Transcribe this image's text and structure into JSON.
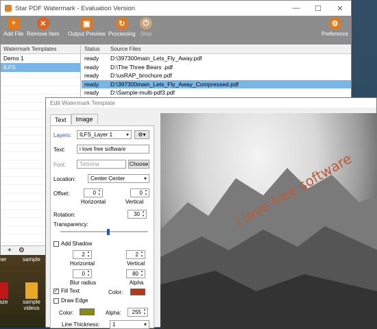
{
  "window": {
    "title": "Star PDF Watermark - Evaluation Version"
  },
  "toolbar": {
    "add_file": "Add File",
    "remove_item": "Remove Item",
    "output_preview": "Output Preview",
    "processing": "Processing",
    "stop": "Stop",
    "preference": "Preference"
  },
  "templates": {
    "header": "Watermark Templates",
    "items": [
      "Demo 1",
      "ILFS"
    ],
    "selected": "ILFS",
    "footer": [
      "+",
      "⚙"
    ]
  },
  "files": {
    "headers": [
      "Status",
      "Source Files"
    ],
    "rows": [
      {
        "status": "ready",
        "path": "D:\\397300main_Lets_Fly_Away.pdf"
      },
      {
        "status": "ready",
        "path": "D:\\The Three Bears .pdf"
      },
      {
        "status": "ready",
        "path": "D:\\usRAP_brochure.pdf"
      },
      {
        "status": "ready",
        "path": "D:\\397300main_Lets_Fly_Away_Compressed.pdf"
      },
      {
        "status": "ready",
        "path": "D:\\Sample-multi-pdf3.pdf"
      }
    ]
  },
  "desktop": {
    "icons": [
      "ner",
      "sample",
      "aze",
      "sample videos"
    ]
  },
  "dialog": {
    "title": "Edit Watermark Template",
    "tabs": [
      "Text",
      "Image"
    ],
    "layers_label": "Layers:",
    "layer_value": "ILFS_Layer 1",
    "text_label": "Text:",
    "text_value": "i love free software",
    "font_label": "Font:",
    "font_value": "Tahoma",
    "choose": "Choose",
    "location_label": "Location:",
    "location_value": "Center Center",
    "offset_label": "Offset:",
    "offset_h": "0",
    "offset_v": "0",
    "horizontal": "Horizontal",
    "vertical": "Vertical",
    "rotation_label": "Rotation:",
    "rotation_value": "30",
    "transparency_label": "Transparency:",
    "add_shadow": "Add Shadow",
    "shadow_h": "2",
    "shadow_v": "2",
    "blur_val": "0",
    "alpha_val": "80",
    "blur_radius": "Blur radius",
    "alpha": "Alpha",
    "fill_text": "Fill Text",
    "color_label": "Color:",
    "draw_edge": "Draw Edge",
    "edge_color_label": "Color:",
    "edge_alpha_label": "Alpha:",
    "edge_alpha": "255",
    "line_thickness": "Line Thickness:",
    "thickness_value": "1",
    "fill_color": "#b03a1a",
    "edge_color": "#8a8a14"
  },
  "preview": {
    "watermark_text": "i love free software",
    "watermark_color": "#b85c38"
  }
}
